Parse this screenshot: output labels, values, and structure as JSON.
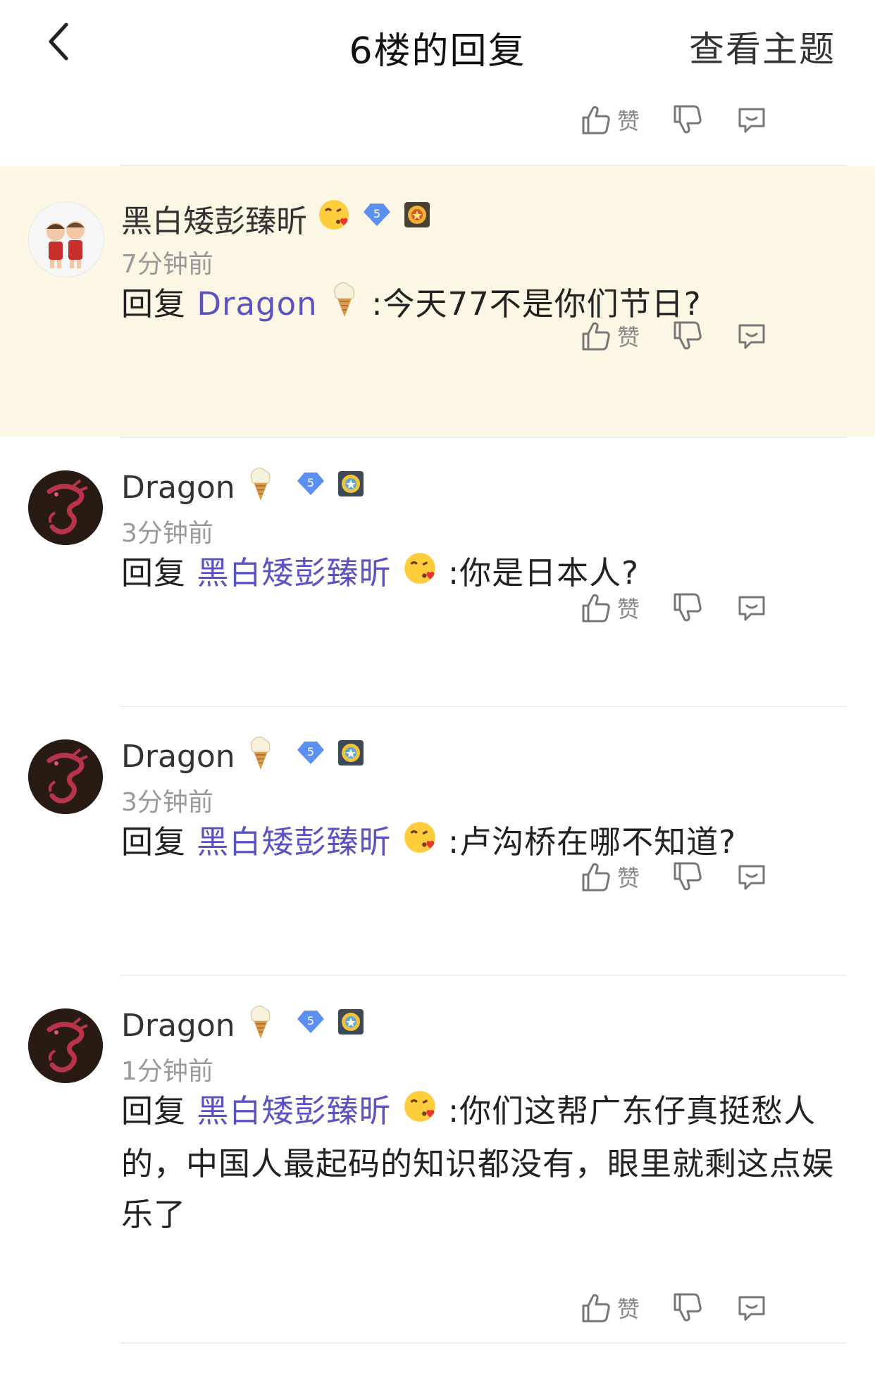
{
  "header": {
    "title": "6楼的回复",
    "right_link": "查看主题"
  },
  "actions": {
    "like_label": "赞"
  },
  "comments": [
    {
      "username": "黑白矮彭臻昕",
      "level": "5",
      "time": "7分钟前",
      "reply_prefix": "回复",
      "mention": "Dragon",
      "text": ":今天77不是你们节日?"
    },
    {
      "username": "Dragon",
      "level": "5",
      "time": "3分钟前",
      "reply_prefix": "回复",
      "mention": "黑白矮彭臻昕",
      "text": ":你是日本人?"
    },
    {
      "username": "Dragon",
      "level": "5",
      "time": "3分钟前",
      "reply_prefix": "回复",
      "mention": "黑白矮彭臻昕",
      "text": ":卢沟桥在哪不知道?"
    },
    {
      "username": "Dragon",
      "level": "5",
      "time": "1分钟前",
      "reply_prefix": "回复",
      "mention": "黑白矮彭臻昕",
      "text": ":你们这帮广东仔真挺愁人的，中国人最起码的知识都没有，眼里就剩这点娱乐了"
    }
  ],
  "colors": {
    "mention": "#5b53c4",
    "highlight_bg": "#fbf7e4",
    "level_badge": "#5b8ff0"
  }
}
